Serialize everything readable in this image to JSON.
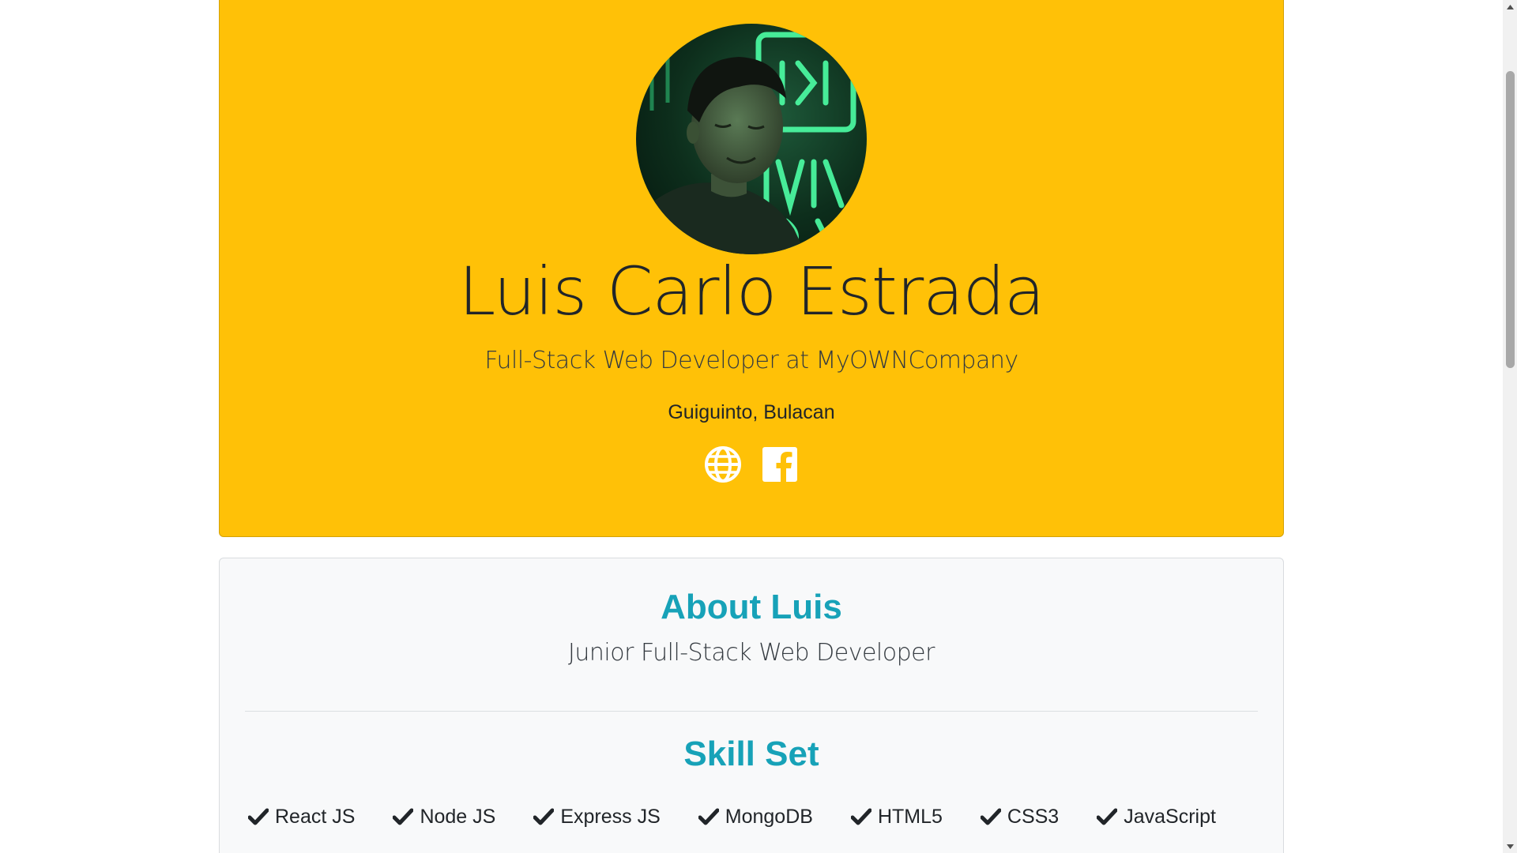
{
  "profile": {
    "name": "Luis Carlo Estrada",
    "title": "Full-Stack Web Developer at MyOWNCompany",
    "location": "Guiguinto, Bulacan",
    "avatar_alt": "profile-photo",
    "social_links": [
      {
        "icon": "globe-icon"
      },
      {
        "icon": "facebook-icon"
      }
    ]
  },
  "about": {
    "heading": "About Luis",
    "subtitle": "Junior Full-Stack Web Developer"
  },
  "skills": {
    "heading": "Skill Set",
    "items": [
      "React JS",
      "Node JS",
      "Express JS",
      "MongoDB",
      "HTML5",
      "CSS3",
      "JavaScript"
    ]
  },
  "colors": {
    "accent_yellow": "#ffc107",
    "heading_teal": "#17a2b8",
    "card_bg": "#f8f9fa",
    "text_dark": "#212529"
  }
}
